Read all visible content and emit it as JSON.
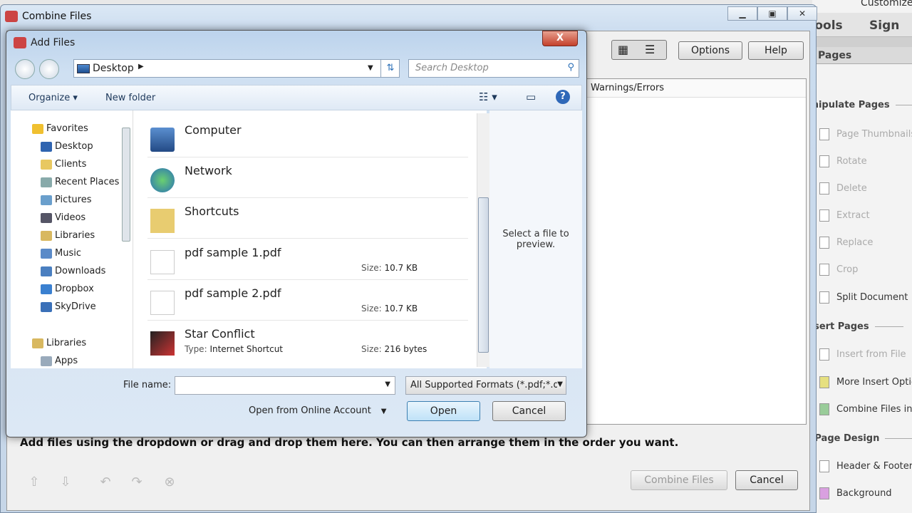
{
  "acrobat": {
    "customize": "Customize",
    "tabs": [
      "Tools",
      "Sign"
    ],
    "panel_title": "Pages",
    "sections": {
      "manipulate": "Manipulate Pages",
      "insert": "Insert Pages",
      "design": "Edit Page Design"
    },
    "manipulate_items": [
      "Page Thumbnails",
      "Rotate",
      "Delete",
      "Extract",
      "Replace",
      "Crop",
      "Split Document"
    ],
    "insert_items": [
      "Insert from File",
      "More Insert Options",
      "Combine Files into PDF"
    ],
    "design_items": [
      "Header & Footer",
      "Background"
    ]
  },
  "combine": {
    "title": "Combine Files",
    "options": "Options",
    "help": "Help",
    "col_warnings": "Warnings/Errors",
    "hint": "Add files using the dropdown or drag and drop them here. You can then arrange them in the order you want.",
    "combine_btn": "Combine Files",
    "cancel": "Cancel"
  },
  "dialog": {
    "title": "Add Files",
    "close": "X",
    "location": "Desktop",
    "search_placeholder": "Search Desktop",
    "toolbar": {
      "organize": "Organize ▾",
      "new_folder": "New folder"
    },
    "nav": {
      "favorites": "Favorites",
      "items": [
        "Desktop",
        "Clients",
        "Recent Places",
        "Pictures",
        "Videos",
        "Libraries",
        "Music",
        "Downloads",
        "Dropbox",
        "SkyDrive"
      ],
      "libraries": "Libraries",
      "lib_items": [
        "Apps"
      ]
    },
    "files": [
      {
        "name": "Computer",
        "type": "",
        "size": ""
      },
      {
        "name": "Network",
        "type": "",
        "size": ""
      },
      {
        "name": "Shortcuts",
        "type": "",
        "size": ""
      },
      {
        "name": "pdf sample 1.pdf",
        "type": "",
        "size": "10.7 KB"
      },
      {
        "name": "pdf sample 2.pdf",
        "type": "",
        "size": "10.7 KB"
      },
      {
        "name": "Star Conflict",
        "type": "Internet Shortcut",
        "size": "216 bytes"
      }
    ],
    "size_label": "Size:",
    "type_label": "Type:",
    "preview": "Select a file to preview.",
    "file_name_label": "File name:",
    "file_name_value": "",
    "filter": "All Supported Formats (*.pdf;*.d",
    "online": "Open from Online Account",
    "open": "Open",
    "cancel": "Cancel"
  }
}
